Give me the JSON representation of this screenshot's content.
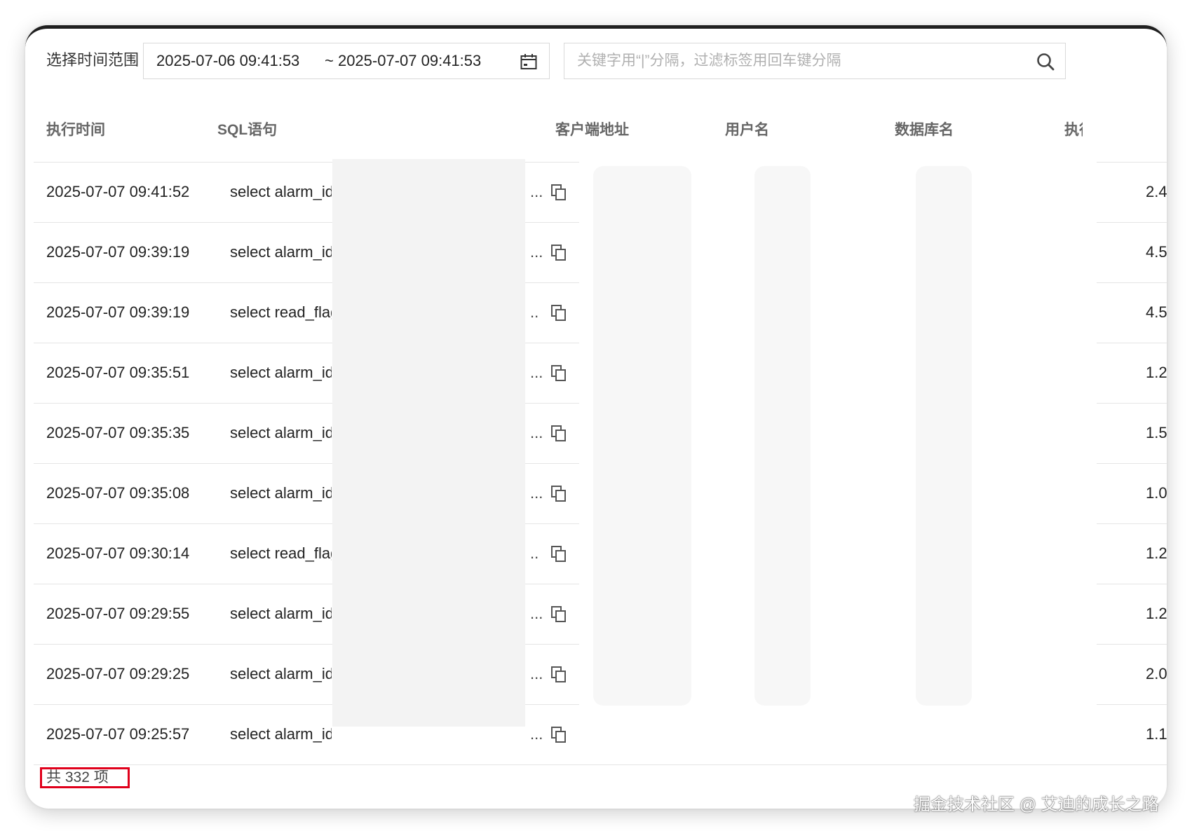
{
  "toolbar": {
    "time_range_label": "选择时间范围",
    "start_time": "2025-07-06 09:41:53",
    "end_time": "~ 2025-07-07 09:41:53",
    "search_placeholder": "关键字用“|”分隔，过滤标签用回车键分隔",
    "search_value": ""
  },
  "table": {
    "columns": [
      "执行时间",
      "SQL语句",
      "客户端地址",
      "用户名",
      "数据库名",
      "执行"
    ],
    "rows": [
      {
        "time": "2025-07-07 09:41:52",
        "sql": "select alarm_id",
        "dots": "...",
        "exec": "2.4"
      },
      {
        "time": "2025-07-07 09:39:19",
        "sql": "select alarm_id",
        "dots": "...",
        "exec": "4.5"
      },
      {
        "time": "2025-07-07 09:39:19",
        "sql": "select read_flag",
        "dots": "..",
        "exec": "4.5"
      },
      {
        "time": "2025-07-07 09:35:51",
        "sql": "select alarm_id",
        "dots": "...",
        "exec": "1.2"
      },
      {
        "time": "2025-07-07 09:35:35",
        "sql": "select alarm_id",
        "dots": "...",
        "exec": "1.5"
      },
      {
        "time": "2025-07-07 09:35:08",
        "sql": "select alarm_id",
        "dots": "...",
        "exec": "1.0"
      },
      {
        "time": "2025-07-07 09:30:14",
        "sql": "select read_flag",
        "dots": "..",
        "exec": "1.2"
      },
      {
        "time": "2025-07-07 09:29:55",
        "sql": "select alarm_id",
        "dots": "...",
        "exec": "1.2"
      },
      {
        "time": "2025-07-07 09:29:25",
        "sql": "select alarm_id",
        "dots": "...",
        "exec": "2.0"
      },
      {
        "time": "2025-07-07 09:25:57",
        "sql": "select alarm_id",
        "dots": "...",
        "exec": "1.1"
      }
    ]
  },
  "footer": {
    "total_text": "共 332 项",
    "highlight_color": "#e0001b"
  },
  "watermark": "掘金技术社区 @ 艾迪的成长之路",
  "icons": {
    "calendar": "calendar-icon",
    "search": "search-icon",
    "copy": "copy-icon"
  }
}
